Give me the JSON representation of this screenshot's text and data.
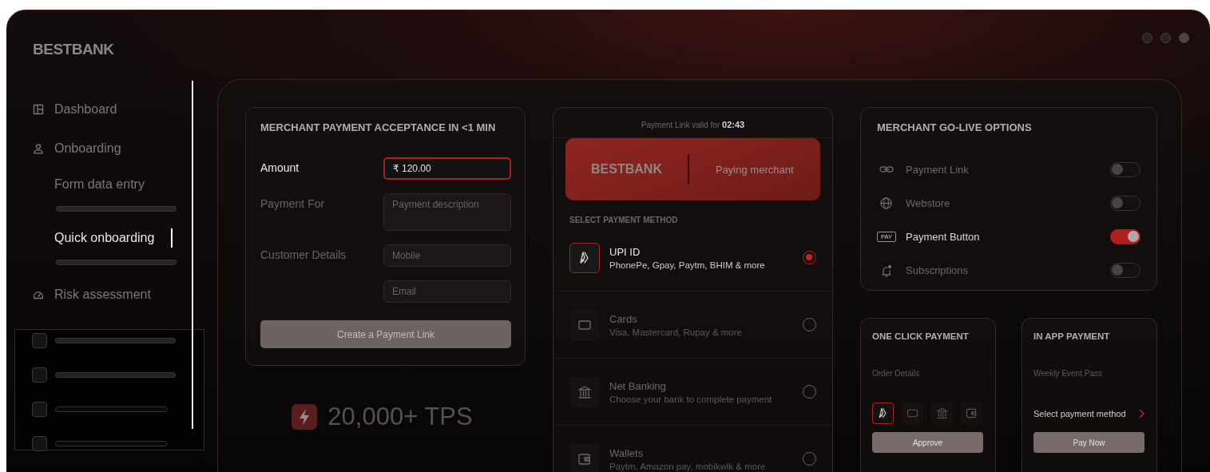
{
  "brand": "BESTBANK",
  "sidebar": {
    "items": [
      {
        "label": "Dashboard",
        "selected": false
      },
      {
        "label": "Onboarding",
        "selected": false,
        "children": [
          {
            "label": "Form data entry",
            "selected": false
          },
          {
            "label": "Quick onboarding",
            "selected": true
          }
        ]
      },
      {
        "label": "Risk assessment",
        "selected": false
      }
    ]
  },
  "acceptance_card": {
    "title": "MERCHANT PAYMENT ACCEPTANCE IN <1 MIN",
    "fields": [
      {
        "label": "Amount",
        "value": "₹ 120.00",
        "kind": "input",
        "focused": true
      },
      {
        "label": "Payment For",
        "placeholder": "Payment description",
        "kind": "textarea",
        "focused": false
      },
      {
        "label": "Customer Details",
        "placeholder": "Mobile",
        "kind": "input",
        "focused": false
      },
      {
        "placeholder": "Email",
        "kind": "input",
        "focused": false
      }
    ],
    "button": {
      "label": "Create a Payment Link",
      "disabled": true
    }
  },
  "throughput": "20,000+ TPS",
  "checkout": {
    "validity_label": "Payment Link valid for",
    "timer": "02:43",
    "banner": {
      "brand": "BESTBANK",
      "caption": "Paying merchant"
    },
    "section_title": "SELECT PAYMENT METHOD",
    "methods": [
      {
        "name": "UPI ID",
        "description": "PhonePe, Gpay, Paytm, BHIM & more",
        "selected": true
      },
      {
        "name": "Cards",
        "description": "Visa, Mastercard, Rupay & more",
        "selected": false
      },
      {
        "name": "Net Banking",
        "description": "Choose your bank to complete payment",
        "selected": false
      },
      {
        "name": "Wallets",
        "description": "Paytm, Amazon pay, mobikwik & more",
        "selected": false
      }
    ]
  },
  "go_live": {
    "title": "MERCHANT GO-LIVE OPTIONS",
    "options": [
      {
        "label": "Payment Link",
        "on": false
      },
      {
        "label": "Webstore",
        "on": false
      },
      {
        "label": "Payment Button",
        "badge": "PAY",
        "on": true
      },
      {
        "label": "Subscriptions",
        "on": false
      }
    ]
  },
  "one_click": {
    "title": "ONE CLICK PAYMENT",
    "subtitle": "Order Details",
    "methods": [
      {
        "selected": true
      },
      {
        "selected": false
      },
      {
        "selected": false
      },
      {
        "selected": false
      }
    ],
    "button": "Approve"
  },
  "in_app": {
    "title": "IN APP PAYMENT",
    "subtitle": "Weekly Event Pass",
    "selector": "Select payment method",
    "button": "Pay Now"
  }
}
